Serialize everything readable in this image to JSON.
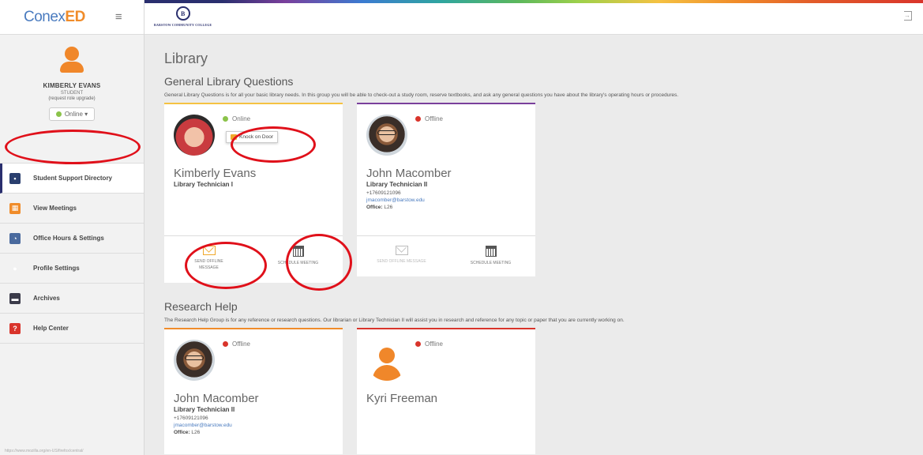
{
  "app": {
    "logo_prefix": "Conex",
    "logo_suffix": "ED",
    "menu_icon": "hamburger-icon"
  },
  "college": {
    "seal_letter": "B",
    "name": "BARSTOW COMMUNITY COLLEGE"
  },
  "user": {
    "name": "KIMBERLY EVANS",
    "role": "STUDENT",
    "upgrade": "(request role upgrade)",
    "status": "Online ▾"
  },
  "nav": {
    "items": [
      {
        "label": "Student Support Directory",
        "icon": "directory-icon"
      },
      {
        "label": "View Meetings",
        "icon": "calendar-icon"
      },
      {
        "label": "Office Hours & Settings",
        "icon": "clock-settings-icon"
      },
      {
        "label": "Profile Settings",
        "icon": "profile-settings-icon"
      },
      {
        "label": "Archives",
        "icon": "archive-icon"
      },
      {
        "label": "Help Center",
        "icon": "help-icon"
      }
    ]
  },
  "footer_url": "https://www.mozilla.org/en-US/firefox/central/",
  "page": {
    "title": "Library"
  },
  "groups": [
    {
      "title": "General Library Questions",
      "description": "General Library Questions is for all your basic library needs. In this group you will be able to check-out a study room, reserve textbooks, and ask any general questions you have about the library's operating hours or procedures.",
      "cards": [
        {
          "status": "Online",
          "knock": "Knock on Door",
          "name": "Kimberly Evans",
          "title": "Library Technician I",
          "action_message": "SEND OFFLINE MESSAGE",
          "action_schedule": "SCHEDULE MEETING"
        },
        {
          "status": "Offline",
          "name": "John Macomber",
          "title": "Library Technician II",
          "phone": "+17609121096",
          "email": "jmacomber@barstow.edu",
          "office_label": "Office:",
          "office": "L26",
          "action_message": "SEND OFFLINE MESSAGE",
          "action_schedule": "SCHEDULE MEETING"
        }
      ]
    },
    {
      "title": "Research Help",
      "description": "The Research Help Group is for any reference or research questions. Our librarian or Library Technician II will assist you in research and reference for any topic or paper that you are currently working on.",
      "cards": [
        {
          "status": "Offline",
          "name": "John Macomber",
          "title": "Library Technician II",
          "phone": "+17609121096",
          "email": "jmacomber@barstow.edu",
          "office_label": "Office:",
          "office": "L26"
        },
        {
          "status": "Offline",
          "name": "Kyri Freeman"
        }
      ]
    }
  ],
  "colors": {
    "brand_blue": "#4a7bbf",
    "brand_orange": "#f08c2a",
    "navy": "#2a2f6e",
    "online": "#8bc34a",
    "offline": "#d9342b",
    "annotation": "#e0101a"
  }
}
